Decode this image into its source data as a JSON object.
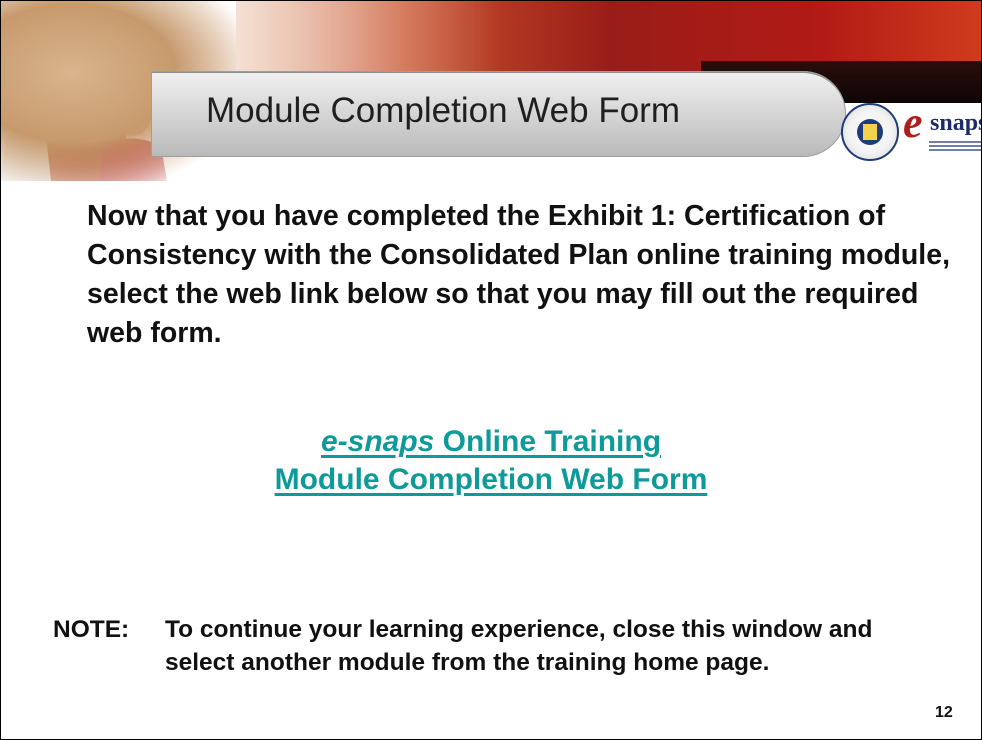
{
  "header": {
    "title": "Module Completion Web Form",
    "logo_brand_letter": "e",
    "logo_brand_word": "snaps"
  },
  "intro": {
    "text": "Now that you have completed the Exhibit 1: Certification of Consistency with the Consolidated Plan online training module, select the web link below so that you may fill out the required web form."
  },
  "link": {
    "line1_italic": "e-snaps",
    "line1_rest": " Online Training",
    "line2": "Module Completion Web Form",
    "color": "#0f9a9a"
  },
  "note": {
    "label": "NOTE:",
    "text": "To continue your learning experience, close this window and select another module from the training home page."
  },
  "page_number": "12",
  "colors": {
    "banner_red": "#9a1c18",
    "title_text": "#1f1f1f",
    "logo_red": "#b01d1d",
    "logo_blue": "#1b2a6b"
  }
}
